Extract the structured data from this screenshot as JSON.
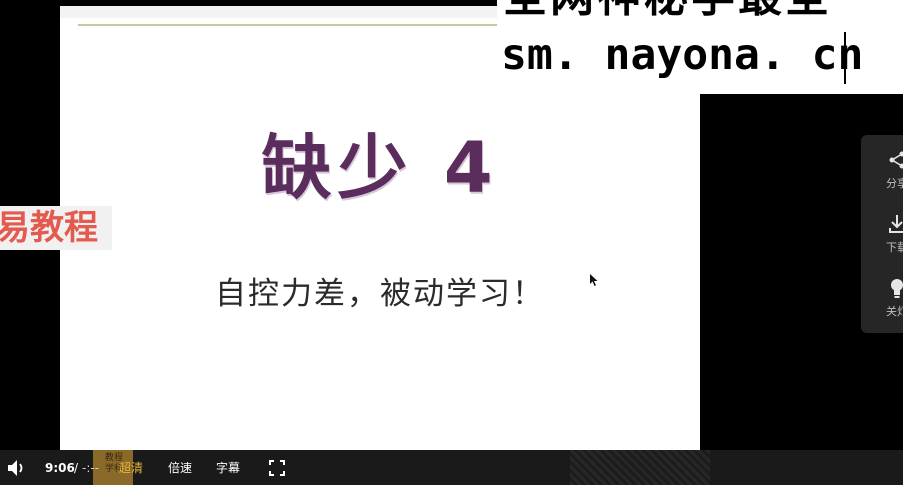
{
  "slide": {
    "title": "缺少 4",
    "subtitle": "自控力差，被动学习！"
  },
  "watermark": {
    "line1": "全网神秘学最全",
    "line2": "sm. nayona. cn",
    "left_text": "易教程"
  },
  "side_panel": {
    "items": [
      {
        "icon": "share-icon",
        "label": "分享"
      },
      {
        "icon": "download-icon",
        "label": "下载"
      },
      {
        "icon": "light-bulb-icon",
        "label": "关灯"
      }
    ]
  },
  "controls": {
    "time_current": "9:06",
    "time_separator": "/",
    "time_total": "-:--",
    "quality_label": "超清",
    "speed_label": "倍速",
    "subtitle_label": "字幕",
    "thumb_text": "教程 学科"
  },
  "colors": {
    "title": "#5a2d5d",
    "quality": "#e8b43a",
    "left_watermark": "#e45a4f",
    "panel_bg": "#262626"
  }
}
